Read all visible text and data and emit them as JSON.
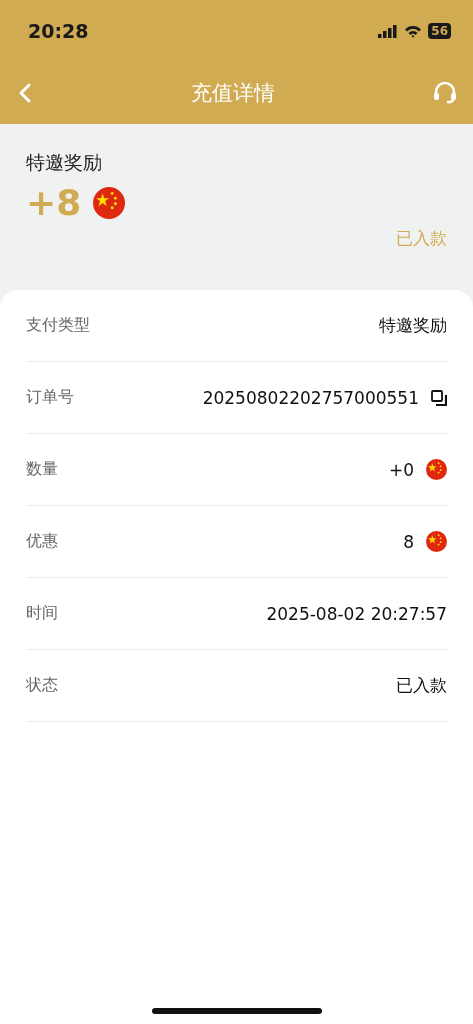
{
  "status_bar": {
    "time": "20:28",
    "battery": "56"
  },
  "nav": {
    "title": "充值详情"
  },
  "summary": {
    "type": "特邀奖励",
    "amount": "+8",
    "status": "已入款"
  },
  "rows": [
    {
      "label": "支付类型",
      "value": "特邀奖励",
      "kind": "text"
    },
    {
      "label": "订单号",
      "value": "20250802202757000551",
      "kind": "copy"
    },
    {
      "label": "数量",
      "value": "+0",
      "kind": "flag"
    },
    {
      "label": "优惠",
      "value": "8",
      "kind": "flag"
    },
    {
      "label": "时间",
      "value": "2025-08-02 20:27:57",
      "kind": "text"
    },
    {
      "label": "状态",
      "value": "已入款",
      "kind": "text"
    }
  ]
}
